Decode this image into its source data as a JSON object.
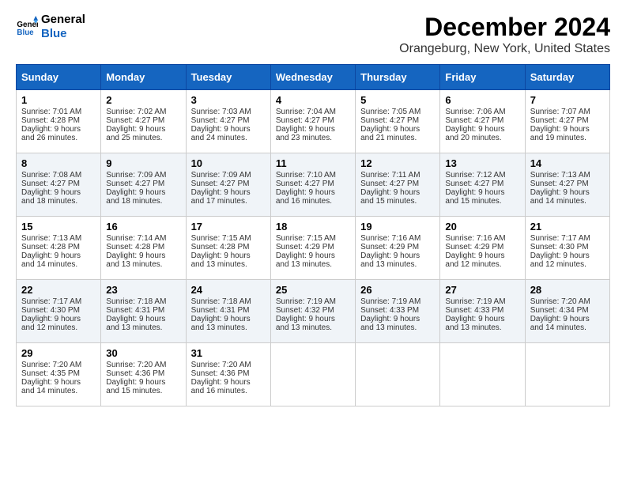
{
  "logo": {
    "line1": "General",
    "line2": "Blue"
  },
  "title": "December 2024",
  "location": "Orangeburg, New York, United States",
  "days_of_week": [
    "Sunday",
    "Monday",
    "Tuesday",
    "Wednesday",
    "Thursday",
    "Friday",
    "Saturday"
  ],
  "weeks": [
    [
      {
        "day": "1",
        "sunrise": "Sunrise: 7:01 AM",
        "sunset": "Sunset: 4:28 PM",
        "daylight": "Daylight: 9 hours and 26 minutes."
      },
      {
        "day": "2",
        "sunrise": "Sunrise: 7:02 AM",
        "sunset": "Sunset: 4:27 PM",
        "daylight": "Daylight: 9 hours and 25 minutes."
      },
      {
        "day": "3",
        "sunrise": "Sunrise: 7:03 AM",
        "sunset": "Sunset: 4:27 PM",
        "daylight": "Daylight: 9 hours and 24 minutes."
      },
      {
        "day": "4",
        "sunrise": "Sunrise: 7:04 AM",
        "sunset": "Sunset: 4:27 PM",
        "daylight": "Daylight: 9 hours and 23 minutes."
      },
      {
        "day": "5",
        "sunrise": "Sunrise: 7:05 AM",
        "sunset": "Sunset: 4:27 PM",
        "daylight": "Daylight: 9 hours and 21 minutes."
      },
      {
        "day": "6",
        "sunrise": "Sunrise: 7:06 AM",
        "sunset": "Sunset: 4:27 PM",
        "daylight": "Daylight: 9 hours and 20 minutes."
      },
      {
        "day": "7",
        "sunrise": "Sunrise: 7:07 AM",
        "sunset": "Sunset: 4:27 PM",
        "daylight": "Daylight: 9 hours and 19 minutes."
      }
    ],
    [
      {
        "day": "8",
        "sunrise": "Sunrise: 7:08 AM",
        "sunset": "Sunset: 4:27 PM",
        "daylight": "Daylight: 9 hours and 18 minutes."
      },
      {
        "day": "9",
        "sunrise": "Sunrise: 7:09 AM",
        "sunset": "Sunset: 4:27 PM",
        "daylight": "Daylight: 9 hours and 18 minutes."
      },
      {
        "day": "10",
        "sunrise": "Sunrise: 7:09 AM",
        "sunset": "Sunset: 4:27 PM",
        "daylight": "Daylight: 9 hours and 17 minutes."
      },
      {
        "day": "11",
        "sunrise": "Sunrise: 7:10 AM",
        "sunset": "Sunset: 4:27 PM",
        "daylight": "Daylight: 9 hours and 16 minutes."
      },
      {
        "day": "12",
        "sunrise": "Sunrise: 7:11 AM",
        "sunset": "Sunset: 4:27 PM",
        "daylight": "Daylight: 9 hours and 15 minutes."
      },
      {
        "day": "13",
        "sunrise": "Sunrise: 7:12 AM",
        "sunset": "Sunset: 4:27 PM",
        "daylight": "Daylight: 9 hours and 15 minutes."
      },
      {
        "day": "14",
        "sunrise": "Sunrise: 7:13 AM",
        "sunset": "Sunset: 4:27 PM",
        "daylight": "Daylight: 9 hours and 14 minutes."
      }
    ],
    [
      {
        "day": "15",
        "sunrise": "Sunrise: 7:13 AM",
        "sunset": "Sunset: 4:28 PM",
        "daylight": "Daylight: 9 hours and 14 minutes."
      },
      {
        "day": "16",
        "sunrise": "Sunrise: 7:14 AM",
        "sunset": "Sunset: 4:28 PM",
        "daylight": "Daylight: 9 hours and 13 minutes."
      },
      {
        "day": "17",
        "sunrise": "Sunrise: 7:15 AM",
        "sunset": "Sunset: 4:28 PM",
        "daylight": "Daylight: 9 hours and 13 minutes."
      },
      {
        "day": "18",
        "sunrise": "Sunrise: 7:15 AM",
        "sunset": "Sunset: 4:29 PM",
        "daylight": "Daylight: 9 hours and 13 minutes."
      },
      {
        "day": "19",
        "sunrise": "Sunrise: 7:16 AM",
        "sunset": "Sunset: 4:29 PM",
        "daylight": "Daylight: 9 hours and 13 minutes."
      },
      {
        "day": "20",
        "sunrise": "Sunrise: 7:16 AM",
        "sunset": "Sunset: 4:29 PM",
        "daylight": "Daylight: 9 hours and 12 minutes."
      },
      {
        "day": "21",
        "sunrise": "Sunrise: 7:17 AM",
        "sunset": "Sunset: 4:30 PM",
        "daylight": "Daylight: 9 hours and 12 minutes."
      }
    ],
    [
      {
        "day": "22",
        "sunrise": "Sunrise: 7:17 AM",
        "sunset": "Sunset: 4:30 PM",
        "daylight": "Daylight: 9 hours and 12 minutes."
      },
      {
        "day": "23",
        "sunrise": "Sunrise: 7:18 AM",
        "sunset": "Sunset: 4:31 PM",
        "daylight": "Daylight: 9 hours and 13 minutes."
      },
      {
        "day": "24",
        "sunrise": "Sunrise: 7:18 AM",
        "sunset": "Sunset: 4:31 PM",
        "daylight": "Daylight: 9 hours and 13 minutes."
      },
      {
        "day": "25",
        "sunrise": "Sunrise: 7:19 AM",
        "sunset": "Sunset: 4:32 PM",
        "daylight": "Daylight: 9 hours and 13 minutes."
      },
      {
        "day": "26",
        "sunrise": "Sunrise: 7:19 AM",
        "sunset": "Sunset: 4:33 PM",
        "daylight": "Daylight: 9 hours and 13 minutes."
      },
      {
        "day": "27",
        "sunrise": "Sunrise: 7:19 AM",
        "sunset": "Sunset: 4:33 PM",
        "daylight": "Daylight: 9 hours and 13 minutes."
      },
      {
        "day": "28",
        "sunrise": "Sunrise: 7:20 AM",
        "sunset": "Sunset: 4:34 PM",
        "daylight": "Daylight: 9 hours and 14 minutes."
      }
    ],
    [
      {
        "day": "29",
        "sunrise": "Sunrise: 7:20 AM",
        "sunset": "Sunset: 4:35 PM",
        "daylight": "Daylight: 9 hours and 14 minutes."
      },
      {
        "day": "30",
        "sunrise": "Sunrise: 7:20 AM",
        "sunset": "Sunset: 4:36 PM",
        "daylight": "Daylight: 9 hours and 15 minutes."
      },
      {
        "day": "31",
        "sunrise": "Sunrise: 7:20 AM",
        "sunset": "Sunset: 4:36 PM",
        "daylight": "Daylight: 9 hours and 16 minutes."
      },
      null,
      null,
      null,
      null
    ]
  ]
}
